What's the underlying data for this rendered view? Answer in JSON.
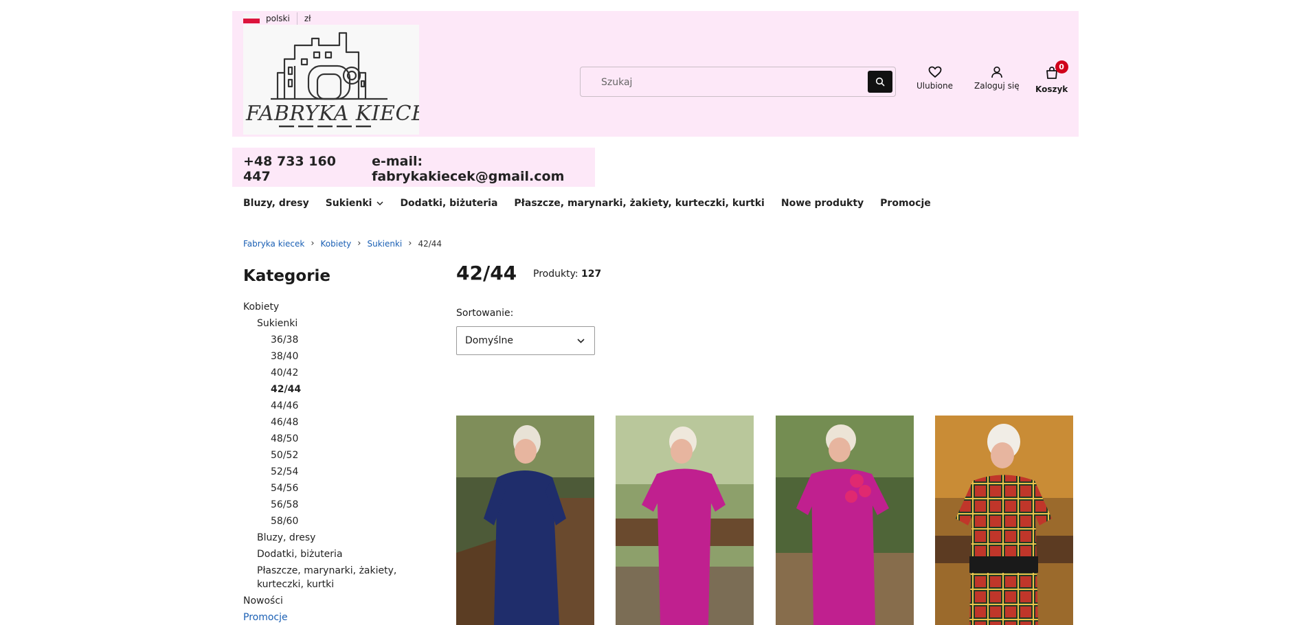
{
  "header": {
    "language": "polski",
    "currency": "zł",
    "logo_text": "FABRYKA KIECEK",
    "search_placeholder": "Szukaj",
    "favorites_label": "Ulubione",
    "login_label": "Zaloguj się",
    "cart_label": "Koszyk",
    "cart_count": "0"
  },
  "contact": {
    "phone": "+48 733 160 447",
    "email": "e-mail: fabrykakiecek@gmail.com"
  },
  "nav": {
    "items": [
      "Bluzy, dresy",
      "Sukienki",
      "Dodatki, biżuteria",
      "Płaszcze, marynarki, żakiety, kurteczki, kurtki",
      "Nowe produkty",
      "Promocje"
    ]
  },
  "breadcrumb": [
    "Fabryka kiecek",
    "Kobiety",
    "Sukienki",
    "42/44"
  ],
  "sidebar": {
    "title": "Kategorie",
    "categories": [
      {
        "label": "Kobiety"
      },
      {
        "label": "Sukienki"
      },
      {
        "label": "36/38"
      },
      {
        "label": "38/40"
      },
      {
        "label": "40/42"
      },
      {
        "label": "42/44"
      },
      {
        "label": "44/46"
      },
      {
        "label": "46/48"
      },
      {
        "label": "48/50"
      },
      {
        "label": "50/52"
      },
      {
        "label": "52/54"
      },
      {
        "label": "54/56"
      },
      {
        "label": "56/58"
      },
      {
        "label": "58/60"
      },
      {
        "label": "Bluzy, dresy"
      },
      {
        "label": "Dodatki, biżuteria"
      },
      {
        "label": "Płaszcze, marynarki, żakiety, kurteczki, kurtki"
      },
      {
        "label": "Nowości"
      },
      {
        "label": "Promocje"
      }
    ]
  },
  "main": {
    "title": "42/44",
    "products_label": "Produkty:",
    "products_count": "127",
    "sort_label": "Sortowanie:",
    "sort_value": "Domyślne"
  },
  "colors": {
    "header_bg": "#fde8f8",
    "link": "#1a5fb4",
    "badge": "#d0021b"
  }
}
